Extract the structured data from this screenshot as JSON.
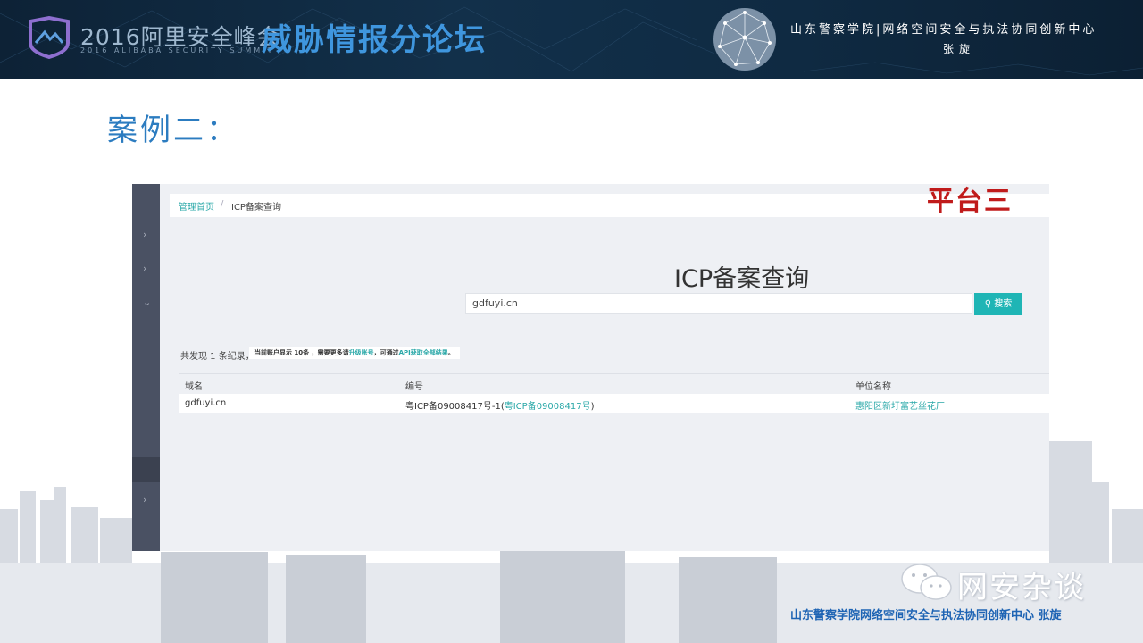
{
  "banner": {
    "brand_main": "2016阿里安全峰会",
    "brand_sub": "2016 ALIBABA SECURITY SUMMIT",
    "forum_title": "威胁情报分论坛",
    "org": "山东警察学院|网络空间安全与执法协同创新中心",
    "author": "张旋"
  },
  "slide": {
    "case_title": "案例二："
  },
  "screenshot": {
    "breadcrumb": {
      "home": "管理首页",
      "separator": "/",
      "current": "ICP备案查询"
    },
    "platform_tag": "平台三",
    "heading": "ICP备案查询",
    "search": {
      "value": "gdfuyi.cn",
      "button_label": "搜索"
    },
    "summary": "共发现 1 条纪录，",
    "notice": {
      "text_before": "当前账户显示 10条 ，需要更多请",
      "upgrade_link": "升级账号",
      "text_middle": "，可通过",
      "api_link": "API获取全部结果",
      "text_after": "。"
    },
    "table": {
      "headers": [
        "域名",
        "编号",
        "单位名称"
      ],
      "rows": [
        {
          "domain": "gdfuyi.cn",
          "number_prefix": "粤ICP备09008417号-1(",
          "number_link": "粤ICP备09008417号",
          "number_suffix": ")",
          "unit": "惠阳区新圩富艺丝花厂"
        }
      ]
    }
  },
  "watermark": {
    "text": "网安杂谈"
  },
  "footer": {
    "org": "山东警察学院网络空间安全与执法协同创新中心  张旋"
  },
  "colors": {
    "banner_bg": "#0f2a42",
    "title_blue": "#2c7cc0",
    "platform_red": "#c01b1b",
    "teal": "#1fb5b5"
  }
}
